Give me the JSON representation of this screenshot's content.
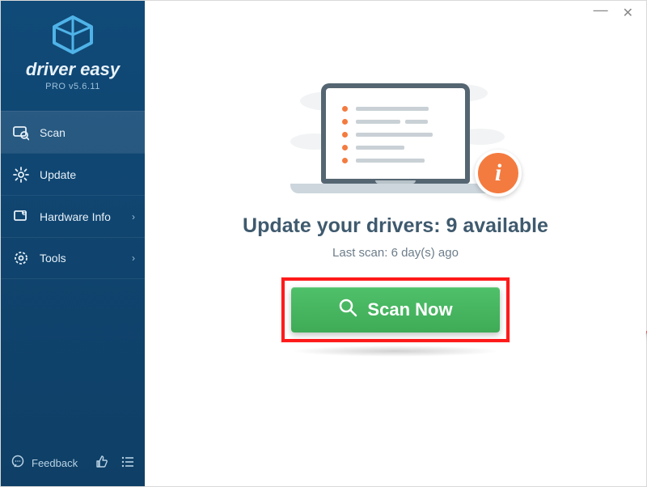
{
  "brand": {
    "name": "driver easy",
    "version": "PRO v5.6.11"
  },
  "sidebar": {
    "items": [
      {
        "label": "Scan",
        "icon": "scan-icon",
        "has_children": false
      },
      {
        "label": "Update",
        "icon": "gear-icon",
        "has_children": false
      },
      {
        "label": "Hardware Info",
        "icon": "hardware-icon",
        "has_children": true
      },
      {
        "label": "Tools",
        "icon": "tools-icon",
        "has_children": true
      }
    ],
    "feedback_label": "Feedback"
  },
  "main": {
    "headline_prefix": "Update your drivers: ",
    "available_count": 9,
    "headline_suffix": " available",
    "last_scan_prefix": "Last scan: ",
    "last_scan_value": "6 day(s) ago",
    "scan_button_label": "Scan Now",
    "info_badge": "i"
  },
  "colors": {
    "sidebar_bg": "#104a78",
    "accent_orange": "#f47b3f",
    "scan_green": "#4fc06a",
    "highlight_red": "#ff1a1a"
  }
}
